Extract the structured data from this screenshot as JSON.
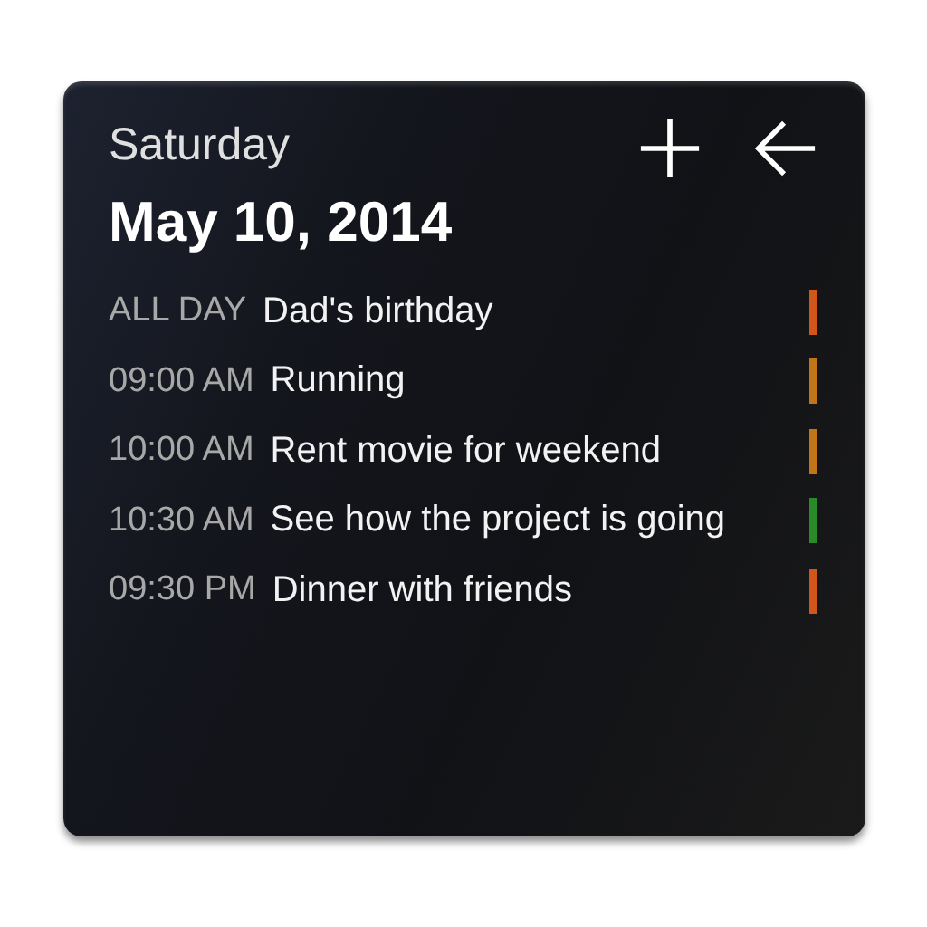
{
  "header": {
    "weekday": "Saturday",
    "date": "May 10, 2014"
  },
  "events": [
    {
      "time": "ALL DAY",
      "title": "Dad's birthday",
      "color": "#d0561c"
    },
    {
      "time": "09:00 AM",
      "title": "Running",
      "color": "#c27418"
    },
    {
      "time": "10:00 AM",
      "title": "Rent movie for weekend",
      "color": "#c27418"
    },
    {
      "time": "10:30 AM",
      "title": "See how the project is going",
      "color": "#2a8a2a"
    },
    {
      "time": "09:30 PM",
      "title": "Dinner with friends",
      "color": "#d0561c"
    }
  ]
}
